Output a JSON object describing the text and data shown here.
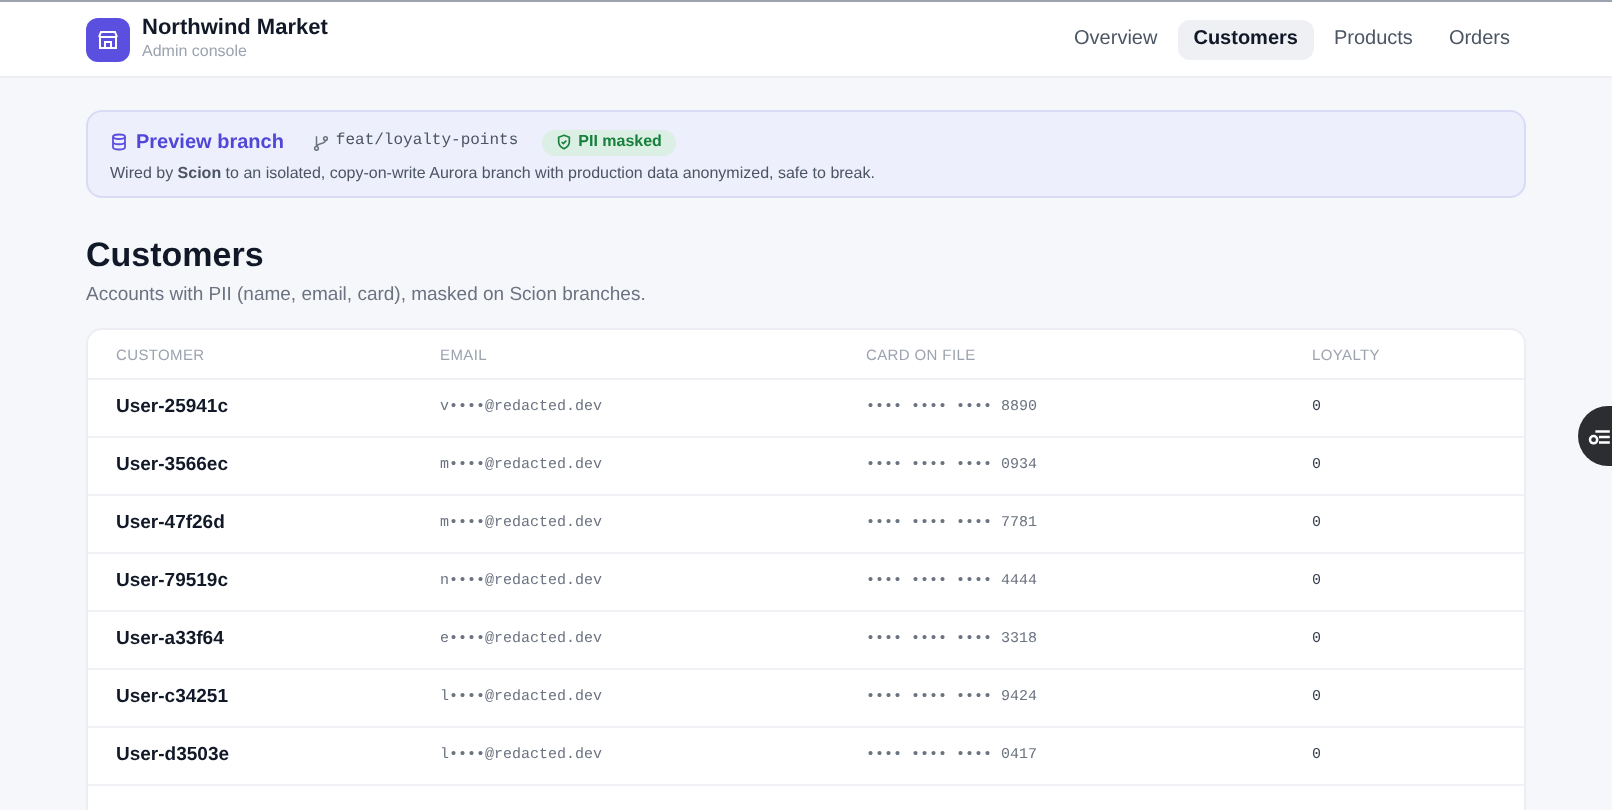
{
  "header": {
    "brand": "Northwind Market",
    "subtitle": "Admin console",
    "nav": [
      {
        "label": "Overview",
        "selected": false
      },
      {
        "label": "Customers",
        "selected": true
      },
      {
        "label": "Products",
        "selected": false
      },
      {
        "label": "Orders",
        "selected": false
      }
    ]
  },
  "banner": {
    "title": "Preview branch",
    "branch": "feat/loyalty-points",
    "badge": "PII masked",
    "description": "Wired by **Scion** to an isolated, copy-on-write Aurora branch with production data anonymized, safe to break."
  },
  "page": {
    "title": "Customers",
    "subtitle": "Accounts with PII (name, email, card), masked on Scion branches."
  },
  "table": {
    "columns": [
      "CUSTOMER",
      "EMAIL",
      "CARD ON FILE",
      "LOYALTY"
    ],
    "rows": [
      {
        "customer": "User-25941c",
        "email": "v••••@redacted.dev",
        "card": "•••• •••• •••• 8890",
        "loyalty": "0"
      },
      {
        "customer": "User-3566ec",
        "email": "m••••@redacted.dev",
        "card": "•••• •••• •••• 0934",
        "loyalty": "0"
      },
      {
        "customer": "User-47f26d",
        "email": "m••••@redacted.dev",
        "card": "•••• •••• •••• 7781",
        "loyalty": "0"
      },
      {
        "customer": "User-79519c",
        "email": "n••••@redacted.dev",
        "card": "•••• •••• •••• 4444",
        "loyalty": "0"
      },
      {
        "customer": "User-a33f64",
        "email": "e••••@redacted.dev",
        "card": "•••• •••• •••• 3318",
        "loyalty": "0"
      },
      {
        "customer": "User-c34251",
        "email": "l••••@redacted.dev",
        "card": "•••• •••• •••• 9424",
        "loyalty": "0"
      },
      {
        "customer": "User-d3503e",
        "email": "l••••@redacted.dev",
        "card": "•••• •••• •••• 0417",
        "loyalty": "0"
      }
    ]
  }
}
